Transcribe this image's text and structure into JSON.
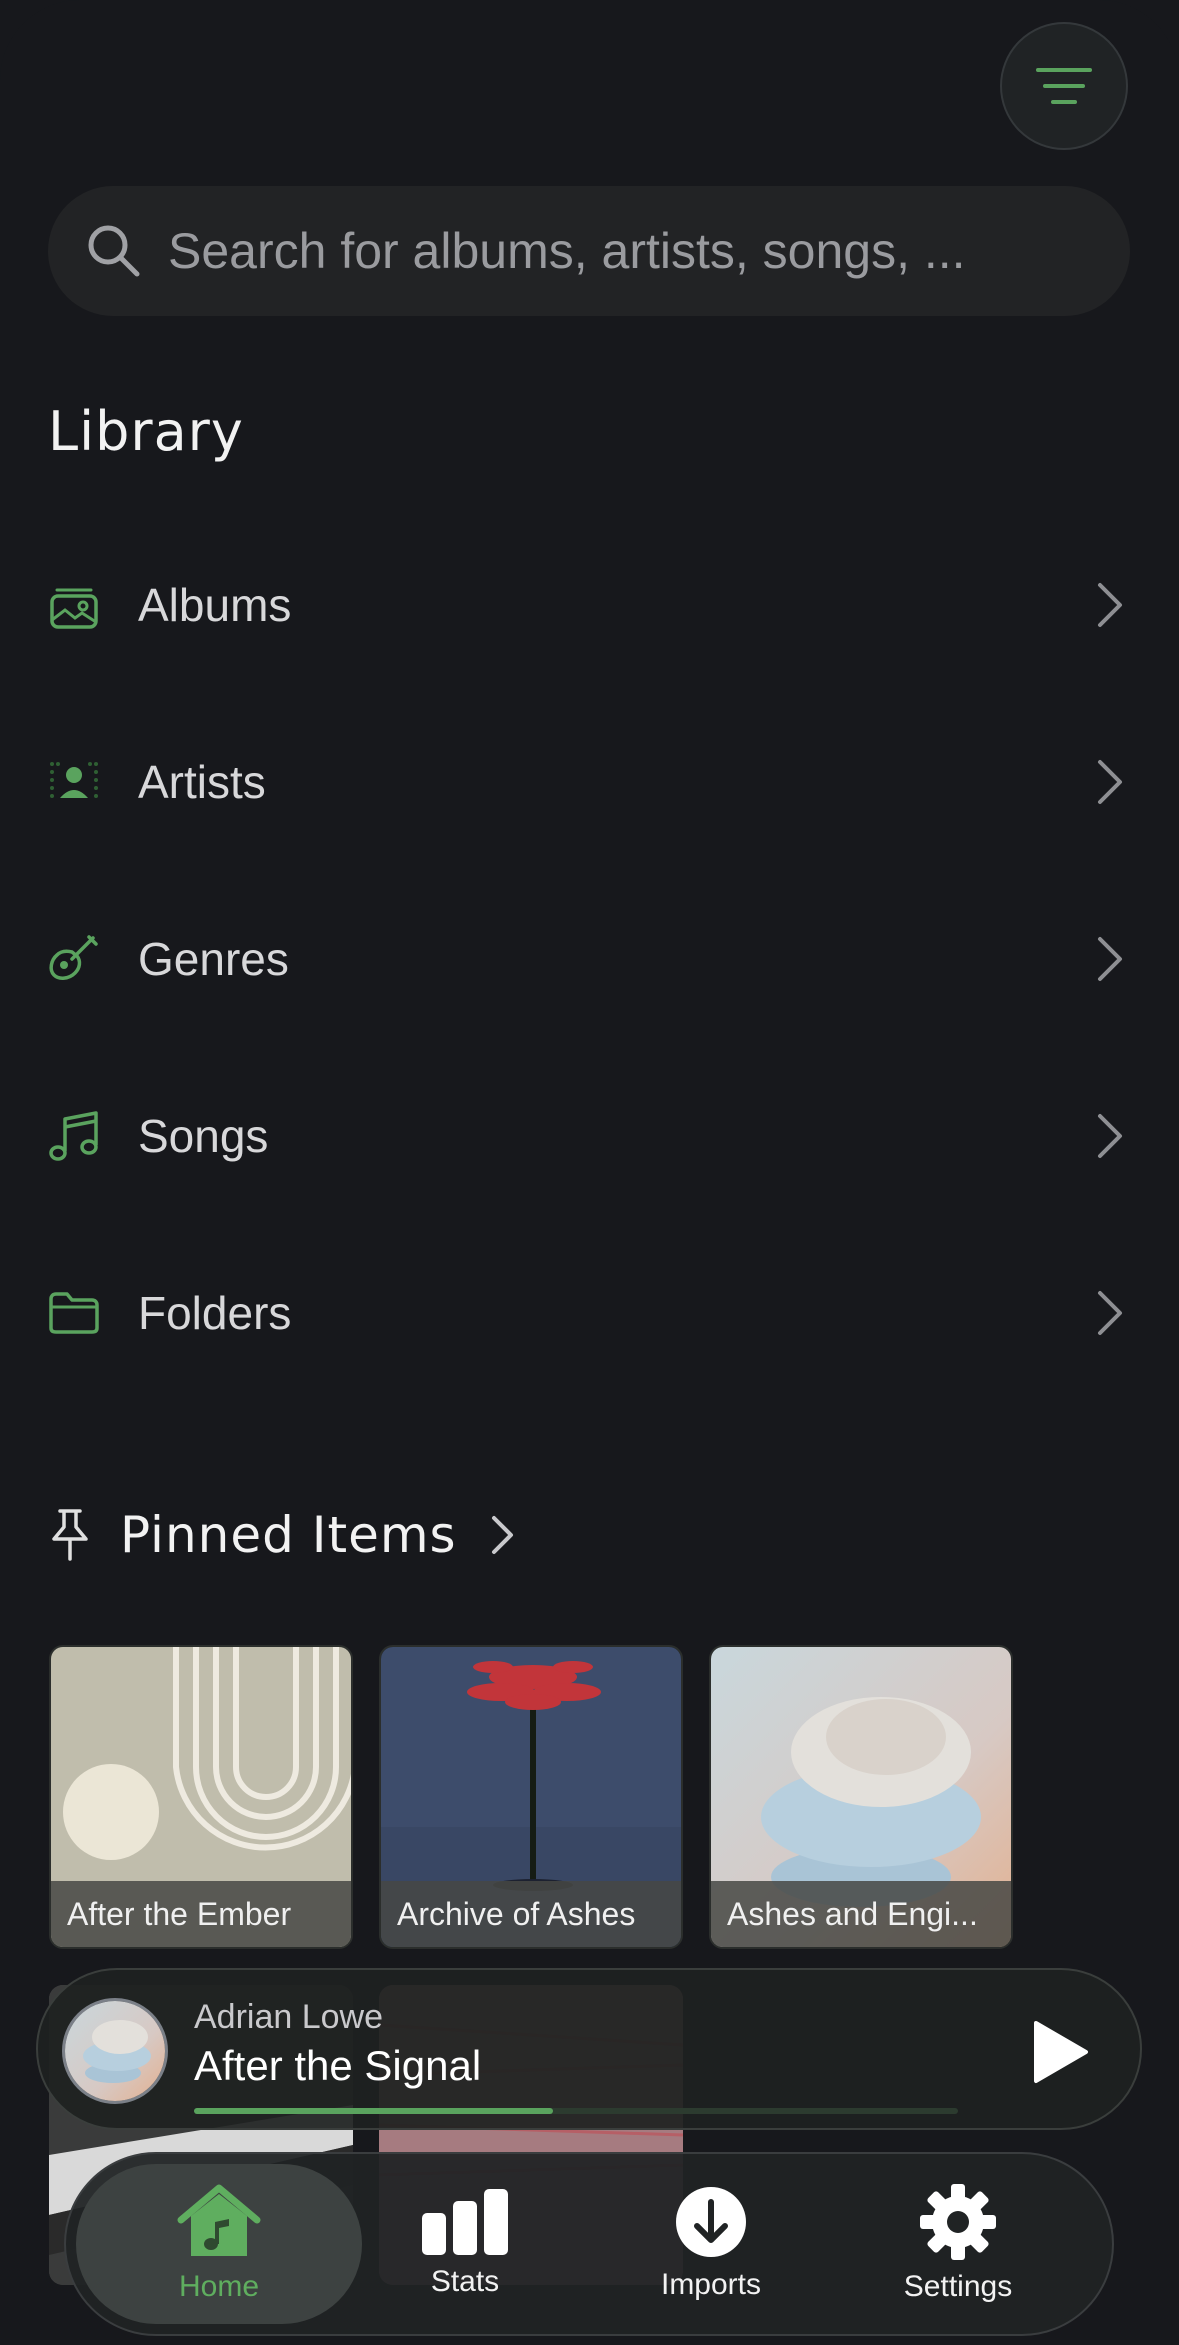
{
  "search": {
    "placeholder": "Search for albums, artists, songs, ..."
  },
  "library": {
    "title": "Library",
    "items": [
      {
        "label": "Albums",
        "icon": "album-icon"
      },
      {
        "label": "Artists",
        "icon": "artist-icon"
      },
      {
        "label": "Genres",
        "icon": "guitar-icon"
      },
      {
        "label": "Songs",
        "icon": "music-note-icon"
      },
      {
        "label": "Folders",
        "icon": "folder-icon"
      }
    ]
  },
  "pinned": {
    "title": "Pinned Items",
    "items": [
      {
        "label": "After the Ember"
      },
      {
        "label": "Archive of Ashes"
      },
      {
        "label": "Ashes and Engi..."
      }
    ]
  },
  "now_playing": {
    "artist": "Adrian Lowe",
    "title": "After the Signal",
    "progress": 0.47
  },
  "tabs": [
    {
      "label": "Home",
      "icon": "home-icon",
      "active": true
    },
    {
      "label": "Stats",
      "icon": "stats-icon",
      "active": false
    },
    {
      "label": "Imports",
      "icon": "download-icon",
      "active": false
    },
    {
      "label": "Settings",
      "icon": "gear-icon",
      "active": false
    }
  ],
  "colors": {
    "accent": "#5aa35e",
    "background": "#17181c"
  }
}
